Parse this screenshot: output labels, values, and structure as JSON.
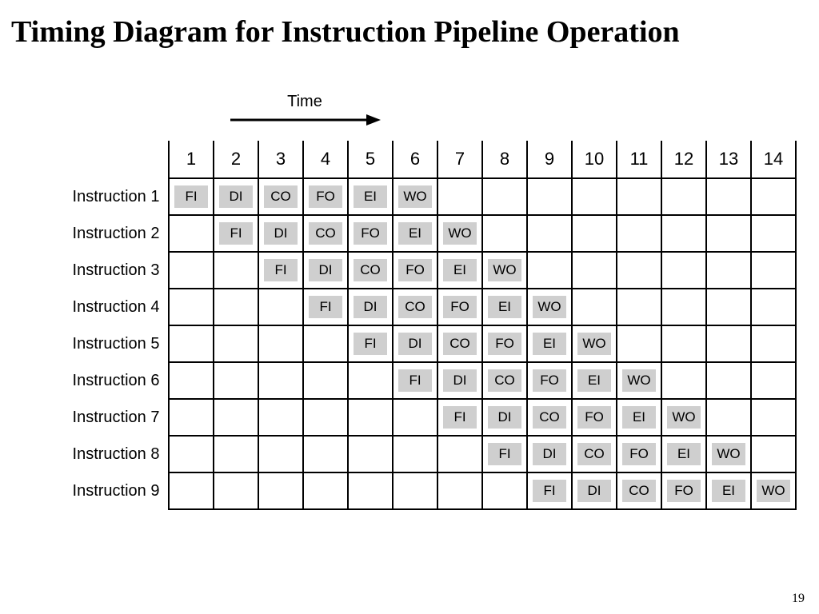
{
  "title": "Timing Diagram for Instruction Pipeline Operation",
  "time_label": "Time",
  "page_number": "19",
  "columns": [
    "1",
    "2",
    "3",
    "4",
    "5",
    "6",
    "7",
    "8",
    "9",
    "10",
    "11",
    "12",
    "13",
    "14"
  ],
  "stages": [
    "FI",
    "DI",
    "CO",
    "FO",
    "EI",
    "WO"
  ],
  "rows": [
    {
      "label": "Instruction 1",
      "start": 1
    },
    {
      "label": "Instruction 2",
      "start": 2
    },
    {
      "label": "Instruction 3",
      "start": 3
    },
    {
      "label": "Instruction 4",
      "start": 4
    },
    {
      "label": "Instruction 5",
      "start": 5
    },
    {
      "label": "Instruction 6",
      "start": 6
    },
    {
      "label": "Instruction 7",
      "start": 7
    },
    {
      "label": "Instruction 8",
      "start": 8
    },
    {
      "label": "Instruction 9",
      "start": 9
    }
  ],
  "chart_data": {
    "type": "table",
    "title": "Timing Diagram for Instruction Pipeline Operation",
    "xlabel": "Time",
    "ylabel": "",
    "categories": [
      "1",
      "2",
      "3",
      "4",
      "5",
      "6",
      "7",
      "8",
      "9",
      "10",
      "11",
      "12",
      "13",
      "14"
    ],
    "series": [
      {
        "name": "Instruction 1",
        "values": [
          "FI",
          "DI",
          "CO",
          "FO",
          "EI",
          "WO",
          "",
          "",
          "",
          "",
          "",
          "",
          "",
          ""
        ]
      },
      {
        "name": "Instruction 2",
        "values": [
          "",
          "FI",
          "DI",
          "CO",
          "FO",
          "EI",
          "WO",
          "",
          "",
          "",
          "",
          "",
          "",
          ""
        ]
      },
      {
        "name": "Instruction 3",
        "values": [
          "",
          "",
          "FI",
          "DI",
          "CO",
          "FO",
          "EI",
          "WO",
          "",
          "",
          "",
          "",
          "",
          ""
        ]
      },
      {
        "name": "Instruction 4",
        "values": [
          "",
          "",
          "",
          "FI",
          "DI",
          "CO",
          "FO",
          "EI",
          "WO",
          "",
          "",
          "",
          "",
          ""
        ]
      },
      {
        "name": "Instruction 5",
        "values": [
          "",
          "",
          "",
          "",
          "FI",
          "DI",
          "CO",
          "FO",
          "EI",
          "WO",
          "",
          "",
          "",
          ""
        ]
      },
      {
        "name": "Instruction 6",
        "values": [
          "",
          "",
          "",
          "",
          "",
          "FI",
          "DI",
          "CO",
          "FO",
          "EI",
          "WO",
          "",
          "",
          ""
        ]
      },
      {
        "name": "Instruction 7",
        "values": [
          "",
          "",
          "",
          "",
          "",
          "",
          "FI",
          "DI",
          "CO",
          "FO",
          "EI",
          "WO",
          "",
          ""
        ]
      },
      {
        "name": "Instruction 8",
        "values": [
          "",
          "",
          "",
          "",
          "",
          "",
          "",
          "FI",
          "DI",
          "CO",
          "FO",
          "EI",
          "WO",
          ""
        ]
      },
      {
        "name": "Instruction 9",
        "values": [
          "",
          "",
          "",
          "",
          "",
          "",
          "",
          "",
          "FI",
          "DI",
          "CO",
          "FO",
          "EI",
          "WO"
        ]
      }
    ]
  }
}
